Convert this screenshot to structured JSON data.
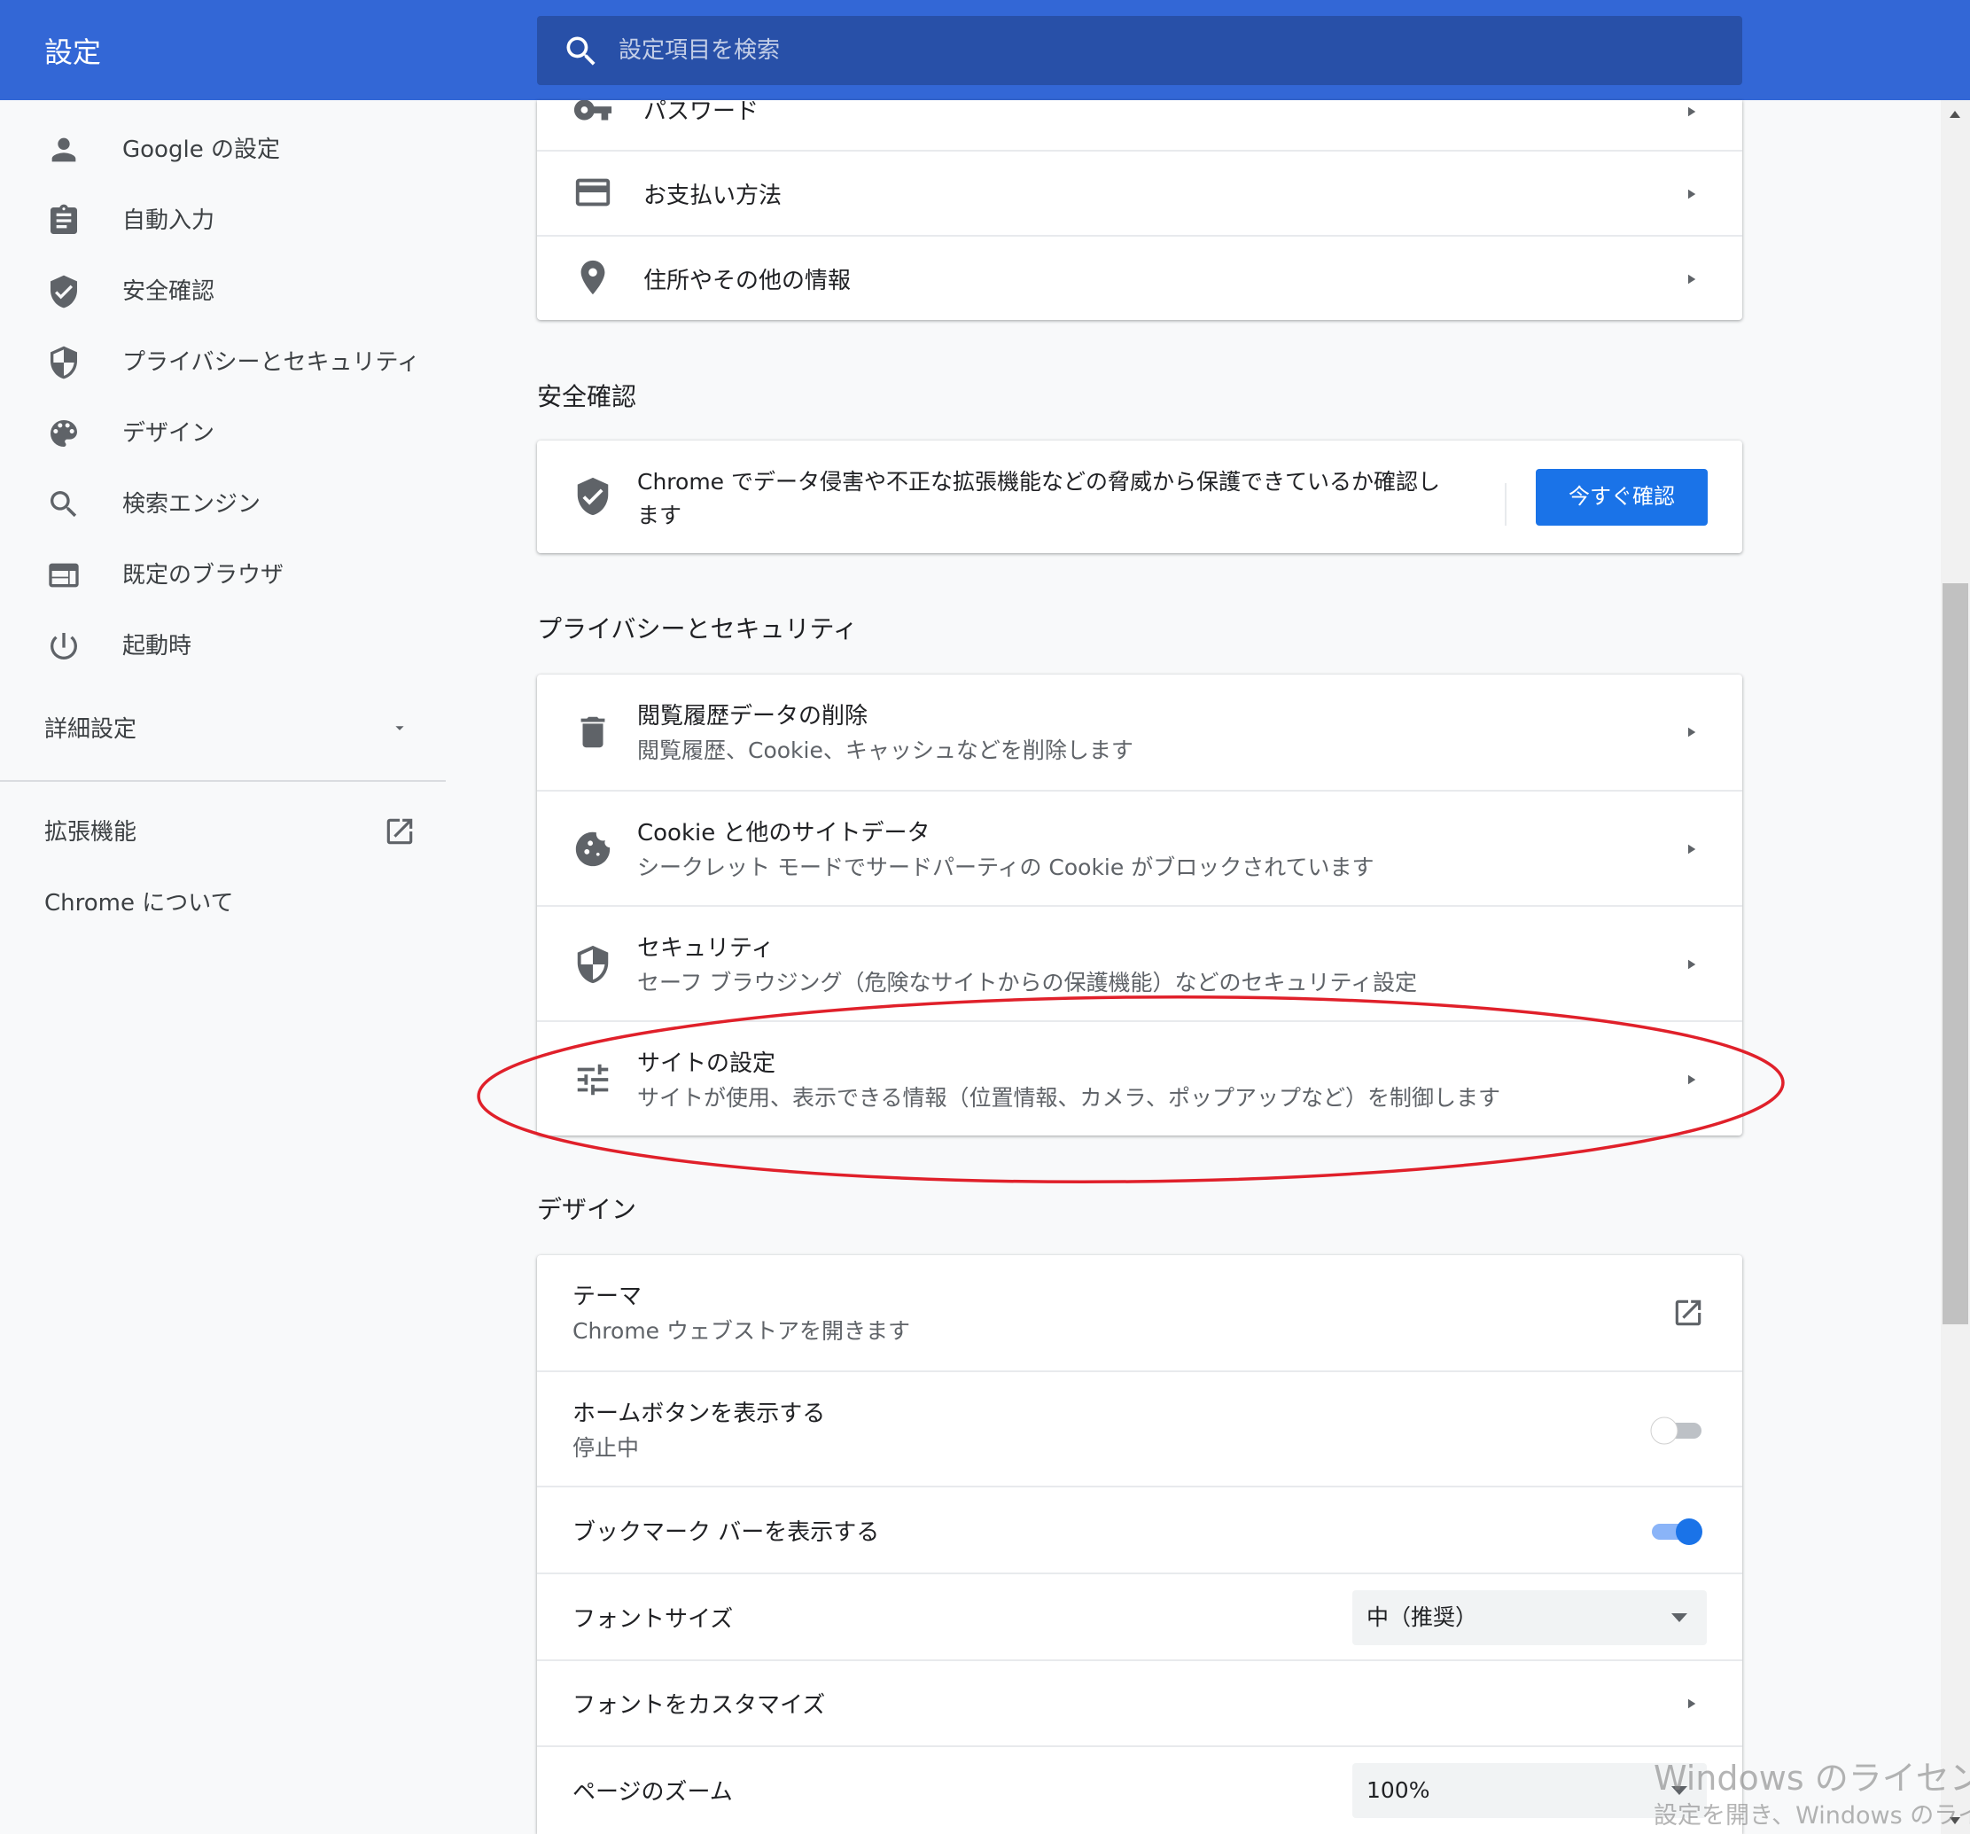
{
  "header": {
    "title": "設定",
    "search_placeholder": "設定項目を検索"
  },
  "sidebar": {
    "items": [
      {
        "label": "Google の設定",
        "icon": "person-icon"
      },
      {
        "label": "自動入力",
        "icon": "clipboard-icon"
      },
      {
        "label": "安全確認",
        "icon": "shield-check-icon"
      },
      {
        "label": "プライバシーとセキュリティ",
        "icon": "shield-half-icon"
      },
      {
        "label": "デザイン",
        "icon": "palette-icon"
      },
      {
        "label": "検索エンジン",
        "icon": "search-icon"
      },
      {
        "label": "既定のブラウザ",
        "icon": "browser-icon"
      },
      {
        "label": "起動時",
        "icon": "power-icon"
      }
    ],
    "advanced_label": "詳細設定",
    "extensions_label": "拡張機能",
    "about_label": "Chrome について"
  },
  "autofill": {
    "passwords": "パスワード",
    "payment": "お支払い方法",
    "addresses": "住所やその他の情報"
  },
  "safety": {
    "heading": "安全確認",
    "text_line1": "Chrome でデータ侵害や不正な拡張機能などの脅威から保護できているか確認し",
    "text_line2": "ます",
    "button": "今すぐ確認"
  },
  "privacy": {
    "heading": "プライバシーとセキュリティ",
    "items": [
      {
        "title": "閲覧履歴データの削除",
        "subtitle": "閲覧履歴、Cookie、キャッシュなどを削除します"
      },
      {
        "title": "Cookie と他のサイトデータ",
        "subtitle": "シークレット モードでサードパーティの Cookie がブロックされています"
      },
      {
        "title": "セキュリティ",
        "subtitle": "セーフ ブラウジング（危険なサイトからの保護機能）などのセキュリティ設定"
      },
      {
        "title": "サイトの設定",
        "subtitle": "サイトが使用、表示できる情報（位置情報、カメラ、ポップアップなど）を制御します"
      }
    ]
  },
  "design": {
    "heading": "デザイン",
    "theme_title": "テーマ",
    "theme_sub": "Chrome ウェブストアを開きます",
    "home_title": "ホームボタンを表示する",
    "home_sub": "停止中",
    "home_enabled": false,
    "bookmarks_title": "ブックマーク バーを表示する",
    "bookmarks_enabled": true,
    "font_size_label": "フォントサイズ",
    "font_size_value": "中（推奨）",
    "customize_fonts": "フォントをカスタマイズ",
    "zoom_label": "ページのズーム",
    "zoom_value": "100%"
  },
  "watermark": {
    "title": "Windows のライセンス",
    "sub": "設定を開き、Windows のライセ"
  },
  "colors": {
    "accent": "#3367d6",
    "button": "#1a73e8",
    "annotation": "#e0202a"
  }
}
